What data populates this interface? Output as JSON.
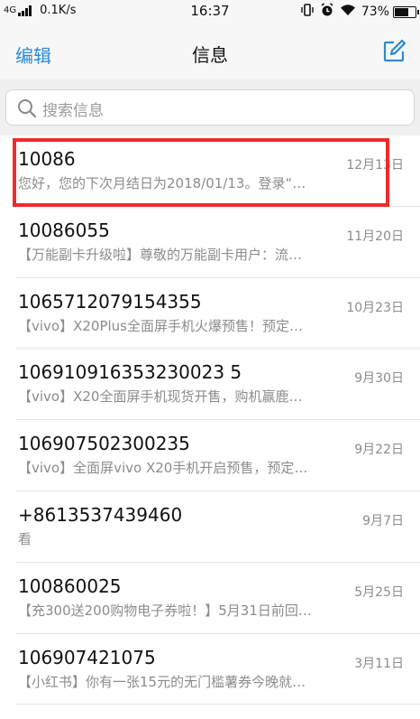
{
  "status_bar": {
    "network": "4G",
    "speed": "0.1K/s",
    "time": "16:37",
    "battery": "73%",
    "battery_level": 0.73,
    "icons": [
      "vibrate-icon",
      "alarm-icon",
      "wifi-icon",
      "battery-icon"
    ]
  },
  "nav": {
    "edit_label": "编辑",
    "title": "信息",
    "compose_icon": "compose-icon"
  },
  "search": {
    "placeholder": "搜索信息"
  },
  "messages": [
    {
      "sender": "10086",
      "preview": "您好，您的下次月结日为2018/01/13。登录“…",
      "date": "12月13日"
    },
    {
      "sender": "10086055",
      "preview": "【万能副卡升级啦】尊敬的万能副卡用户：流…",
      "date": "11月20日"
    },
    {
      "sender": "1065712079154355",
      "preview": "【vivo】X20Plus全面屏手机火爆预售！预定…",
      "date": "10月23日"
    },
    {
      "sender": "106910916353230023 5",
      "preview": "【vivo】X20全面屏手机现货开售，购机赢鹿…",
      "date": "9月30日"
    },
    {
      "sender": "106907502300235",
      "preview": "【vivo】全面屏vivo X20手机开启预售，预定…",
      "date": "9月22日"
    },
    {
      "sender": "+8613537439460",
      "preview": "看",
      "date": "9月7日"
    },
    {
      "sender": "100860025",
      "preview": "【充300送200购物电子券啦！】5月31日前回…",
      "date": "5月25日"
    },
    {
      "sender": "106907421075",
      "preview": "【小红书】你有一张15元的无门槛薯券今晚就…",
      "date": "3月11日"
    }
  ],
  "colors": {
    "accent": "#2a8ad8",
    "highlight": "#ef2b2b"
  }
}
